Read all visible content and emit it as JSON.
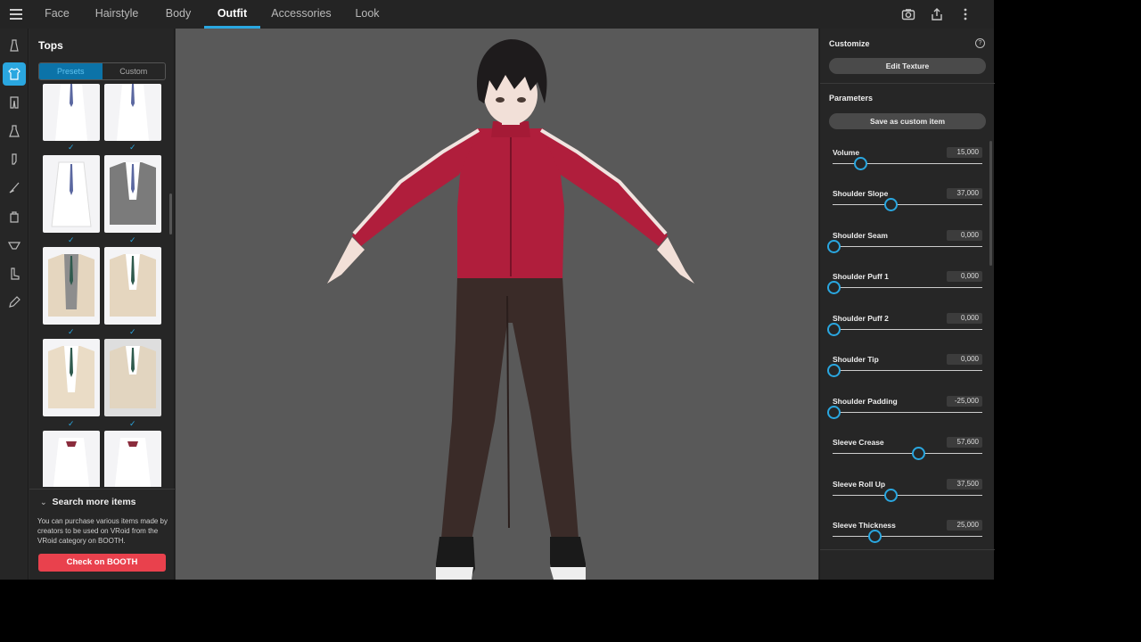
{
  "tabs": [
    "Face",
    "Hairstyle",
    "Body",
    "Outfit",
    "Accessories",
    "Look"
  ],
  "active_tab": "Outfit",
  "top_icons": [
    "camera-icon",
    "share-icon",
    "more-vert-icon"
  ],
  "rail_icons": [
    "dress-icon",
    "shirt-icon",
    "pants-icon",
    "onepiece-icon",
    "sock-icon",
    "brush-icon",
    "bag-icon",
    "underwear-icon",
    "shoe-icon",
    "pen-icon"
  ],
  "left_panel": {
    "title": "Tops",
    "seg": {
      "presets": "Presets",
      "custom": "Custom"
    },
    "more": {
      "header": "Search more items",
      "description": "You can purchase various items made by creators to be used on VRoid from the VRoid category on BOOTH.",
      "button": "Check on BOOTH"
    }
  },
  "right_panel": {
    "customize": "Customize",
    "help": "?",
    "edit_texture": "Edit Texture",
    "parameters": "Parameters",
    "save_custom": "Save as custom item",
    "params": [
      {
        "label": "Volume",
        "value": "15,000",
        "pos": 0.18
      },
      {
        "label": "Shoulder Slope",
        "value": "37,000",
        "pos": 0.385
      },
      {
        "label": "Shoulder Seam",
        "value": "0,000",
        "pos": 0.0
      },
      {
        "label": "Shoulder Puff 1",
        "value": "0,000",
        "pos": 0.0
      },
      {
        "label": "Shoulder Puff 2",
        "value": "0,000",
        "pos": 0.0
      },
      {
        "label": "Shoulder Tip",
        "value": "0,000",
        "pos": 0.0
      },
      {
        "label": "Shoulder Padding",
        "value": "-25,000",
        "pos": 0.0
      },
      {
        "label": "Sleeve Crease",
        "value": "57,600",
        "pos": 0.57
      },
      {
        "label": "Sleeve Roll Up",
        "value": "37,500",
        "pos": 0.385
      },
      {
        "label": "Sleeve Thickness",
        "value": "25,000",
        "pos": 0.275
      }
    ]
  },
  "colors": {
    "accent": "#2aa7e0",
    "booth": "#e9414d",
    "jacket": "#b01e3c",
    "pants": "#3a2b28"
  }
}
